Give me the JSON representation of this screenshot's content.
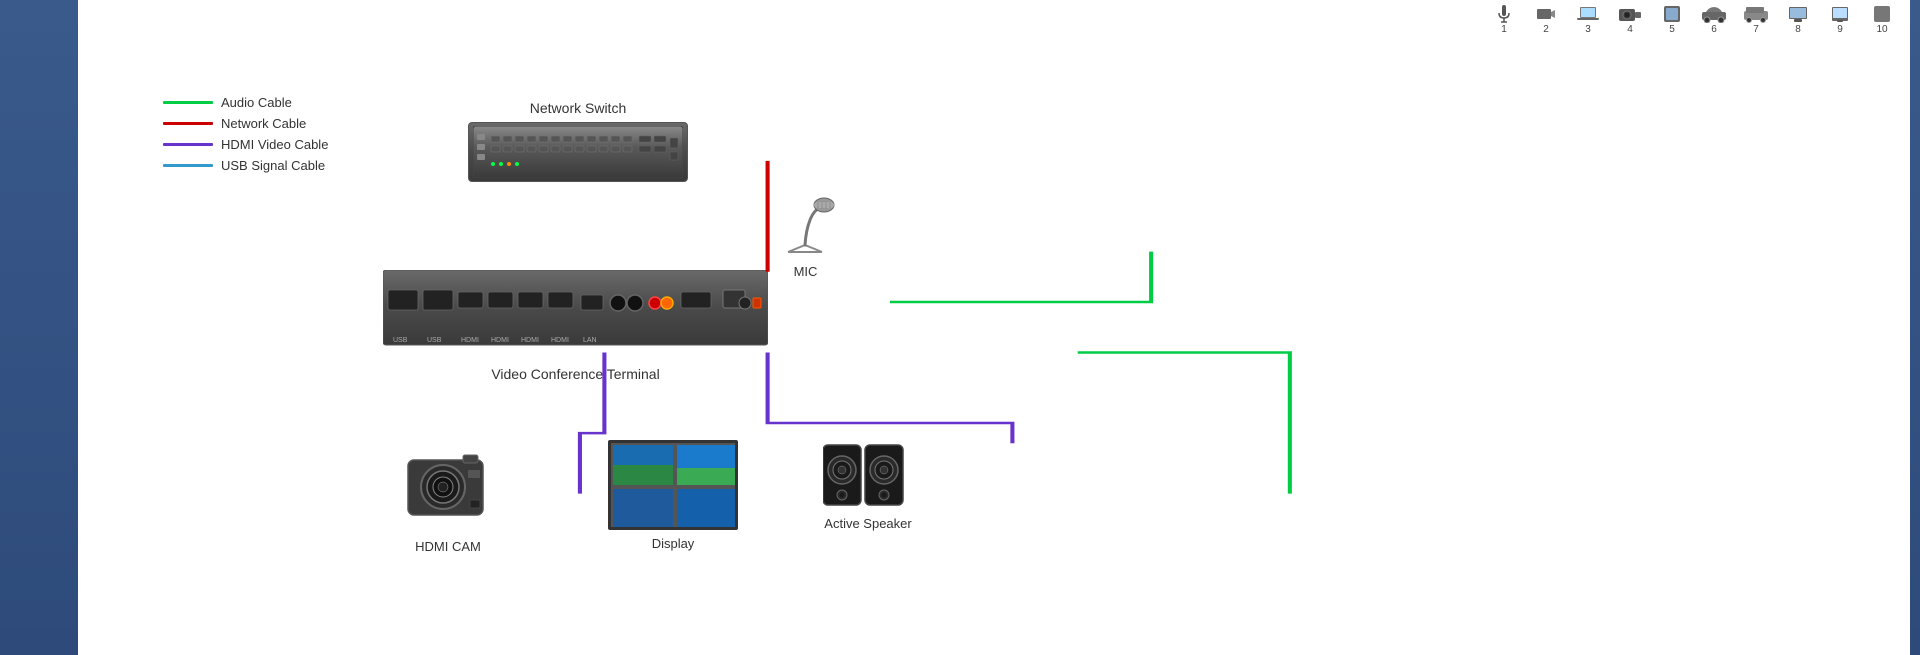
{
  "legend": {
    "items": [
      {
        "label": "Audio Cable",
        "color": "#00cc44"
      },
      {
        "label": "Network Cable",
        "color": "#cc0000"
      },
      {
        "label": "HDMI Video Cable",
        "color": "#6633cc"
      },
      {
        "label": "USB Signal Cable",
        "color": "#3399cc"
      }
    ]
  },
  "devices": {
    "networkSwitch": {
      "label": "Network Switch"
    },
    "vct": {
      "label": "Video Conference Terminal"
    },
    "mic": {
      "label": "MIC"
    },
    "cam": {
      "label": "HDMI CAM"
    },
    "display": {
      "label": "Display"
    },
    "speaker": {
      "label": "Active Speaker"
    }
  },
  "thumbnails": [
    {
      "num": "1"
    },
    {
      "num": "2"
    },
    {
      "num": "3"
    },
    {
      "num": "4"
    },
    {
      "num": "5"
    },
    {
      "num": "6"
    },
    {
      "num": "7"
    },
    {
      "num": "8"
    },
    {
      "num": "9"
    },
    {
      "num": "10"
    }
  ]
}
